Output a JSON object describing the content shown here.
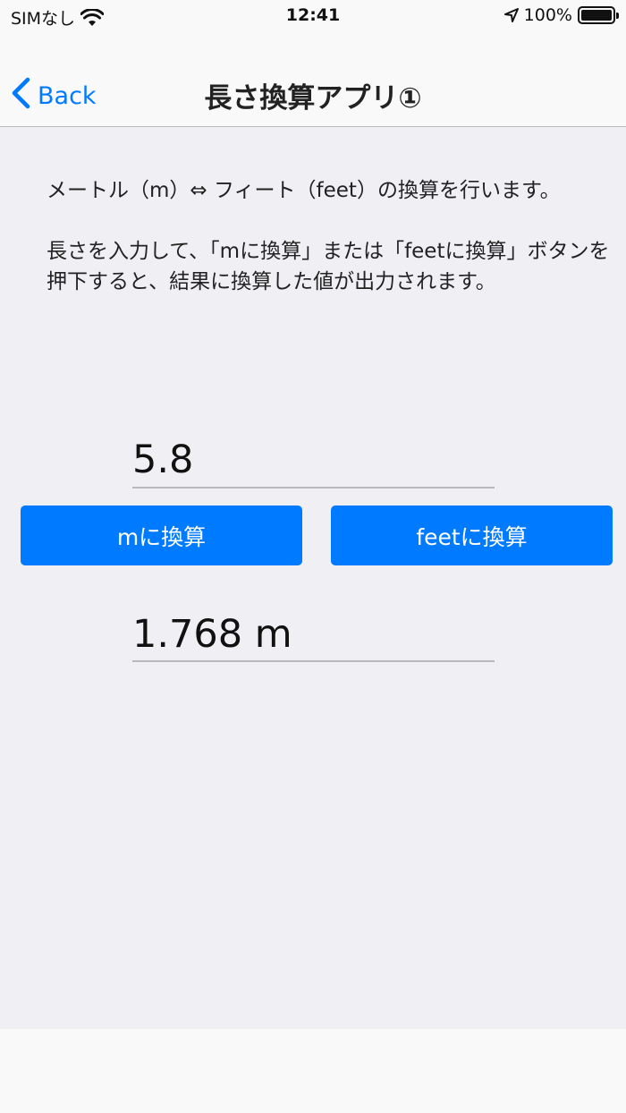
{
  "status_bar": {
    "carrier": "SIMなし",
    "time": "12:41",
    "battery": "100%"
  },
  "nav": {
    "back_label": "Back",
    "title": "長さ換算アプリ①"
  },
  "description": {
    "line1": "メートル（m）⇔ フィート（feet）の換算を行います。",
    "line2": "長さを入力して、「mに換算」または「feetに換算」ボタンを押下すると、結果に換算した値が出力されます。"
  },
  "input": {
    "value": "5.8"
  },
  "buttons": {
    "to_m": "mに換算",
    "to_feet": "feetに換算"
  },
  "result": {
    "value": "1.768 m"
  },
  "colors": {
    "accent": "#007aff",
    "background": "#efeff4"
  }
}
